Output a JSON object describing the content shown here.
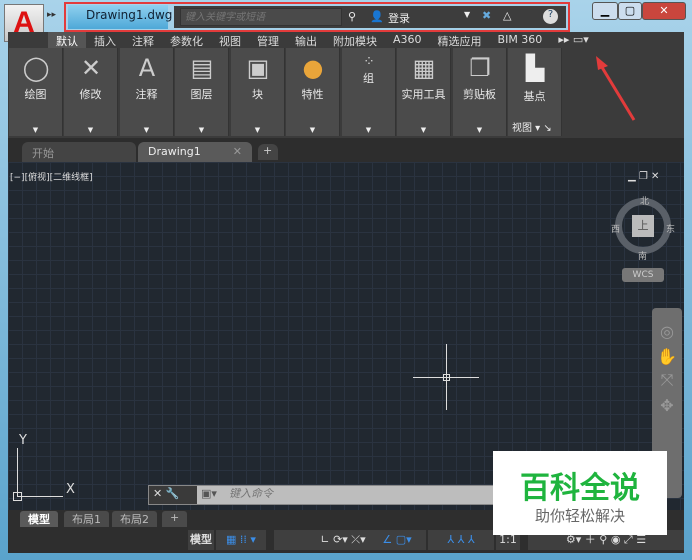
{
  "title": {
    "document": "Drawing1.dwg",
    "search_placeholder": "键入关键字或短语",
    "sign_in": "登录"
  },
  "ribbon_tabs": [
    "默认",
    "插入",
    "注释",
    "参数化",
    "视图",
    "管理",
    "输出",
    "附加模块",
    "A360",
    "精选应用",
    "BIM 360"
  ],
  "panels": [
    {
      "label": "绘图",
      "icon": "◯"
    },
    {
      "label": "修改",
      "icon": "✕"
    },
    {
      "label": "注释",
      "icon": "A"
    },
    {
      "label": "图层",
      "icon": "▤"
    },
    {
      "label": "块",
      "icon": "▣"
    },
    {
      "label": "特性",
      "icon": "●"
    },
    {
      "label": "组",
      "icon": "⁘"
    },
    {
      "label": "实用工具",
      "icon": "▦"
    },
    {
      "label": "剪贴板",
      "icon": "❐"
    },
    {
      "label": "基点",
      "icon": "▙"
    }
  ],
  "view_panel_label": "视图",
  "doc_tabs": {
    "start": "开始",
    "drawing": "Drawing1"
  },
  "viewport_label": "[−][俯视][二维线框]",
  "viewcube": {
    "face": "上",
    "n": "北",
    "s": "南",
    "e": "东",
    "w": "西",
    "wcs": "WCS"
  },
  "ucs": {
    "x": "X",
    "y": "Y"
  },
  "command": {
    "placeholder": "键入命令"
  },
  "layout_tabs": [
    "模型",
    "布局1",
    "布局2"
  ],
  "status": {
    "model": "模型",
    "scale": "1:1"
  },
  "watermark": {
    "title": "百科全说",
    "subtitle": "助你轻松解决"
  },
  "colors": {
    "highlight": "#e23b3b",
    "watermark_green": "#1fb43e"
  }
}
